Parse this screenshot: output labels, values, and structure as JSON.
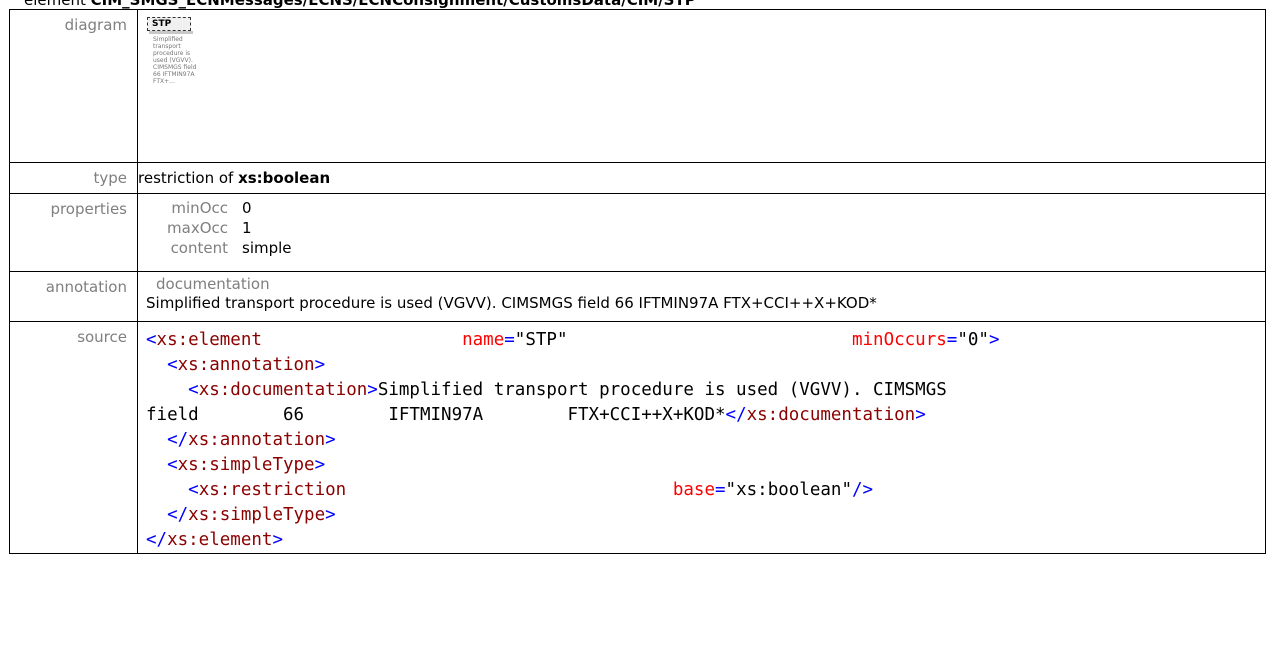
{
  "title": {
    "prefix": "element ",
    "path": "CIM_SMGS_ECNMessages/ECNS/ECNConsignment/CustomsData/CIM/STP"
  },
  "rows": {
    "diagram": {
      "label": "diagram",
      "element_name": "STP",
      "doc_text": "Simplified transport procedure is used (VGVV). CIMSMGS field 66 IFTMIN97A FTX+..."
    },
    "type": {
      "label": "type",
      "prefix": "restriction of ",
      "base": "xs:boolean"
    },
    "properties": {
      "label": "properties",
      "items": [
        {
          "key": "minOcc",
          "value": "0"
        },
        {
          "key": "maxOcc",
          "value": "1"
        },
        {
          "key": "content",
          "value": "simple"
        }
      ]
    },
    "annotation": {
      "label": "annotation",
      "heading": "documentation",
      "text": "Simplified transport procedure is used (VGVV). CIMSMGS field 66 IFTMIN97A FTX+CCI++X+KOD*"
    },
    "source": {
      "label": "source",
      "tag_element_open": "xs:element",
      "attr_name": "name",
      "attr_name_val": "\"STP\"",
      "attr_minoccurs": "minOccurs",
      "attr_minoccurs_val": "\"0\"",
      "tag_annotation": "xs:annotation",
      "tag_documentation": "xs:documentation",
      "doc_line1": "Simplified transport procedure is used (VGVV). CIMSMGS",
      "doc_line2_a": "field",
      "doc_line2_b": "66",
      "doc_line2_c": "IFTMIN97A",
      "doc_line2_d": "FTX+CCI++X+KOD*",
      "tag_simpletype": "xs:simpleType",
      "tag_restriction": "xs:restriction",
      "attr_base": "base",
      "attr_base_val": "\"xs:boolean\""
    }
  },
  "colors": {
    "tag": "#8b0000",
    "bracket": "#0000ff",
    "attribute": "#ff0000",
    "label": "#7f7f7f"
  }
}
